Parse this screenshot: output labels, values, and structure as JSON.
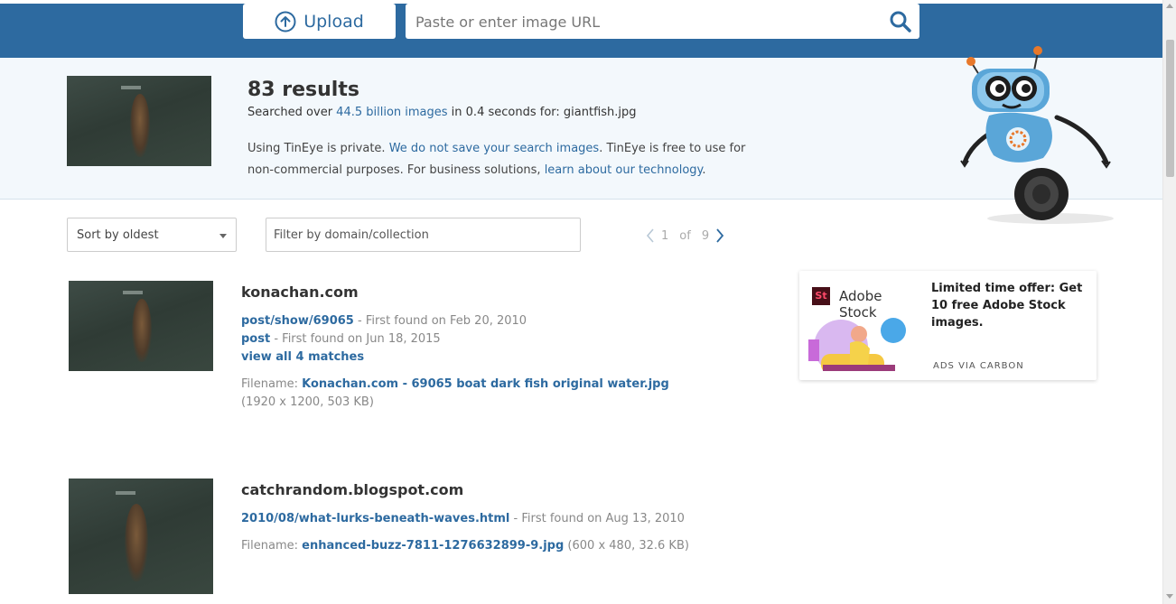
{
  "header": {
    "upload_label": "Upload",
    "url_placeholder": "Paste or enter image URL",
    "brand_color": "#2d6aa0"
  },
  "summary": {
    "results": "83 results",
    "searched_prefix": "Searched over ",
    "searched_link": "44.5 billion images",
    "searched_middle": " in 0.4 seconds for: ",
    "query_file": "giantfish.jpg",
    "privacy_1": "Using TinEye is private. ",
    "privacy_link_1": "We do not save your search images",
    "privacy_2": ". TinEye is free to use for non-commercial purposes. For business solutions, ",
    "privacy_link_2": "learn about our technology",
    "privacy_3": "."
  },
  "controls": {
    "sort_value": "Sort by oldest",
    "filter_placeholder": "Filter by domain/collection",
    "page_current": "1",
    "page_of": "of",
    "page_total": "9"
  },
  "results": [
    {
      "domain": "konachan.com",
      "matches": [
        {
          "link": "post/show/69065",
          "found": " - First found on Feb 20, 2010"
        },
        {
          "link": "post",
          "found": " - First found on Jun 18, 2015"
        }
      ],
      "view_all": "view all 4 matches",
      "filename_label": "Filename: ",
      "filename": "Konachan.com - 69065 boat dark fish original water.jpg",
      "fileinfo": "(1920 x 1200, 503 KB)"
    },
    {
      "domain": "catchrandom.blogspot.com",
      "matches": [
        {
          "link": "2010/08/what-lurks-beneath-waves.html",
          "found": " - First found on Aug 13, 2010"
        }
      ],
      "filename_label": "Filename: ",
      "filename": "enhanced-buzz-7811-1276632899-9.jpg",
      "fileinfo": " (600 x 480, 32.6 KB)"
    }
  ],
  "ad": {
    "logo_text": "St",
    "brand": "Adobe Stock",
    "text": "Limited time offer: Get 10 free Adobe Stock images.",
    "via": "ADS VIA CARBON"
  }
}
